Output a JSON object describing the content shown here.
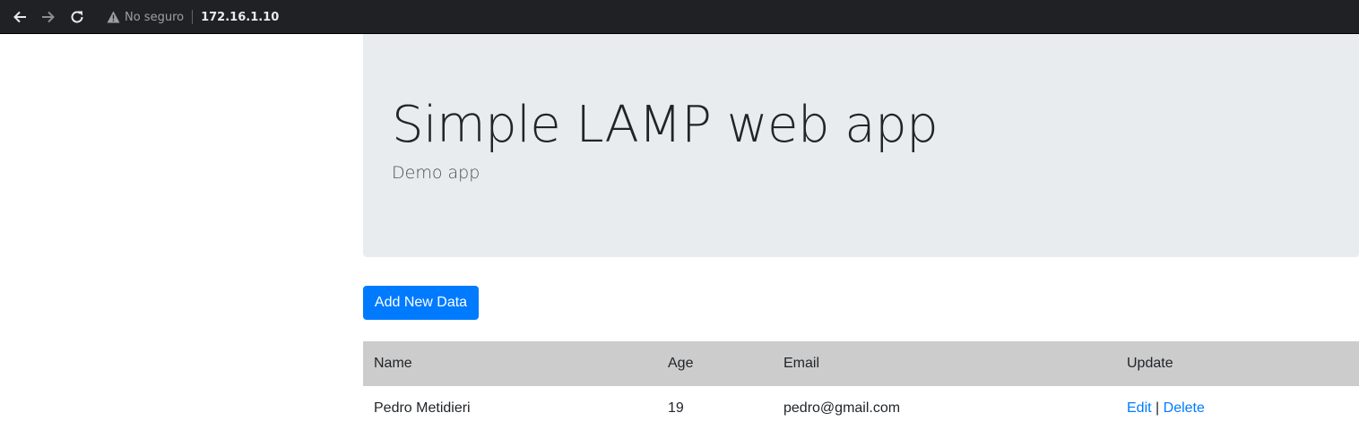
{
  "browser": {
    "not_secure_label": "No seguro",
    "url": "172.16.1.10",
    "icons": [
      "back-arrow-icon",
      "forward-arrow-icon",
      "reload-icon",
      "warning-icon"
    ]
  },
  "header": {
    "title": "Simple LAMP web app",
    "subtitle": "Demo app"
  },
  "actions": {
    "add_label": "Add New Data"
  },
  "table": {
    "headers": {
      "name": "Name",
      "age": "Age",
      "email": "Email",
      "update": "Update"
    },
    "rows": [
      {
        "name": "Pedro Metidieri",
        "age": "19",
        "email": "pedro@gmail.com",
        "edit": "Edit",
        "separator": "|",
        "delete": "Delete"
      }
    ]
  },
  "colors": {
    "primary": "#007bff",
    "jumbotron_bg": "#e9ecef",
    "table_header_bg": "#cccccc",
    "chrome_bg": "#202124"
  }
}
